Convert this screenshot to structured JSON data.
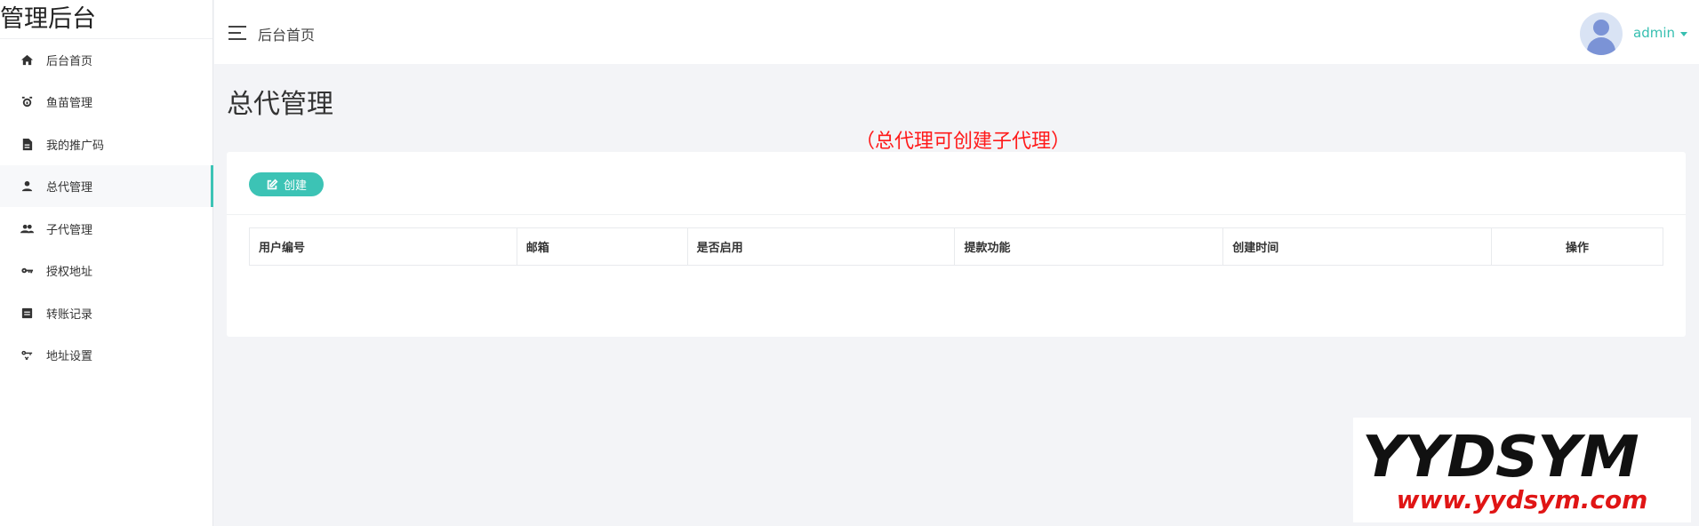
{
  "brand": {
    "title": "管理后台"
  },
  "sidebar": {
    "items": [
      {
        "label": "后台首页",
        "icon": "home-icon"
      },
      {
        "label": "鱼苗管理",
        "icon": "gauge-icon"
      },
      {
        "label": "我的推广码",
        "icon": "document-icon"
      },
      {
        "label": "总代管理",
        "icon": "user-icon",
        "active": true
      },
      {
        "label": "子代管理",
        "icon": "users-icon"
      },
      {
        "label": "授权地址",
        "icon": "key-icon"
      },
      {
        "label": "转账记录",
        "icon": "list-icon"
      },
      {
        "label": "地址设置",
        "icon": "key-settings-icon"
      }
    ]
  },
  "topbar": {
    "breadcrumb": "后台首页",
    "user": "admin"
  },
  "main": {
    "title": "总代管理",
    "notice": "（总代理可创建子代理）",
    "create_label": "创建",
    "table": {
      "headers": [
        "用户编号",
        "邮箱",
        "是否启用",
        "提款功能",
        "创建时间",
        "操作"
      ],
      "rows": []
    }
  },
  "watermark": {
    "logo": "YYDSYM",
    "url": "www.yydsym.com"
  },
  "colors": {
    "accent": "#3cc3b5",
    "notice": "#ff1a1a",
    "background": "#f3f4f7"
  }
}
